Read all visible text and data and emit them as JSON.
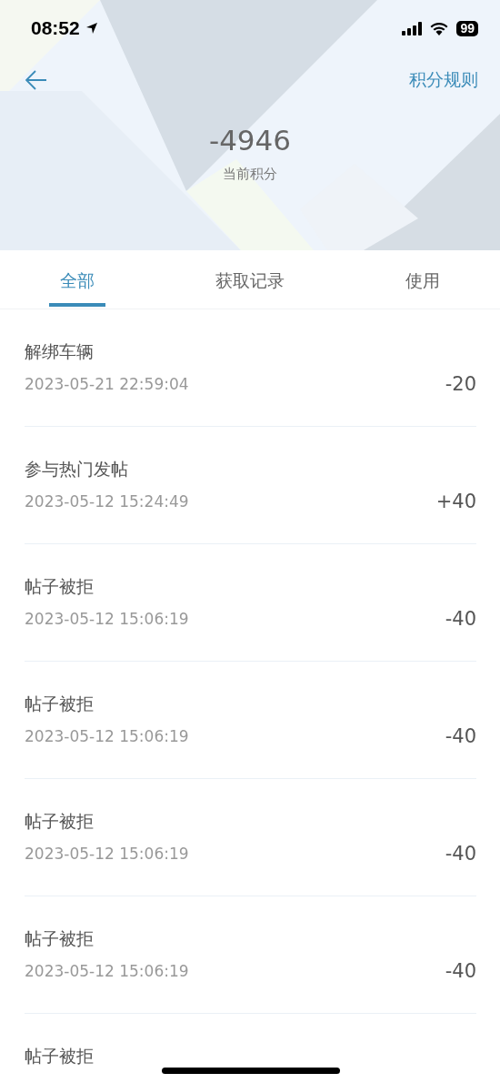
{
  "status_bar": {
    "time": "08:52",
    "battery": "99"
  },
  "nav": {
    "title": "积分规则"
  },
  "summary": {
    "points": "-4946",
    "label": "当前积分"
  },
  "tabs": [
    {
      "label": "全部",
      "selected": true
    },
    {
      "label": "获取记录",
      "selected": false
    },
    {
      "label": "使用",
      "selected": false
    }
  ],
  "records": [
    {
      "title": "解绑车辆",
      "time": "2023-05-21 22:59:04",
      "amount": "-20"
    },
    {
      "title": "参与热门发帖",
      "time": "2023-05-12 15:24:49",
      "amount": "+40"
    },
    {
      "title": "帖子被拒",
      "time": "2023-05-12 15:06:19",
      "amount": "-40"
    },
    {
      "title": "帖子被拒",
      "time": "2023-05-12 15:06:19",
      "amount": "-40"
    },
    {
      "title": "帖子被拒",
      "time": "2023-05-12 15:06:19",
      "amount": "-40"
    },
    {
      "title": "帖子被拒",
      "time": "2023-05-12 15:06:19",
      "amount": "-40"
    },
    {
      "title": "帖子被拒"
    }
  ]
}
